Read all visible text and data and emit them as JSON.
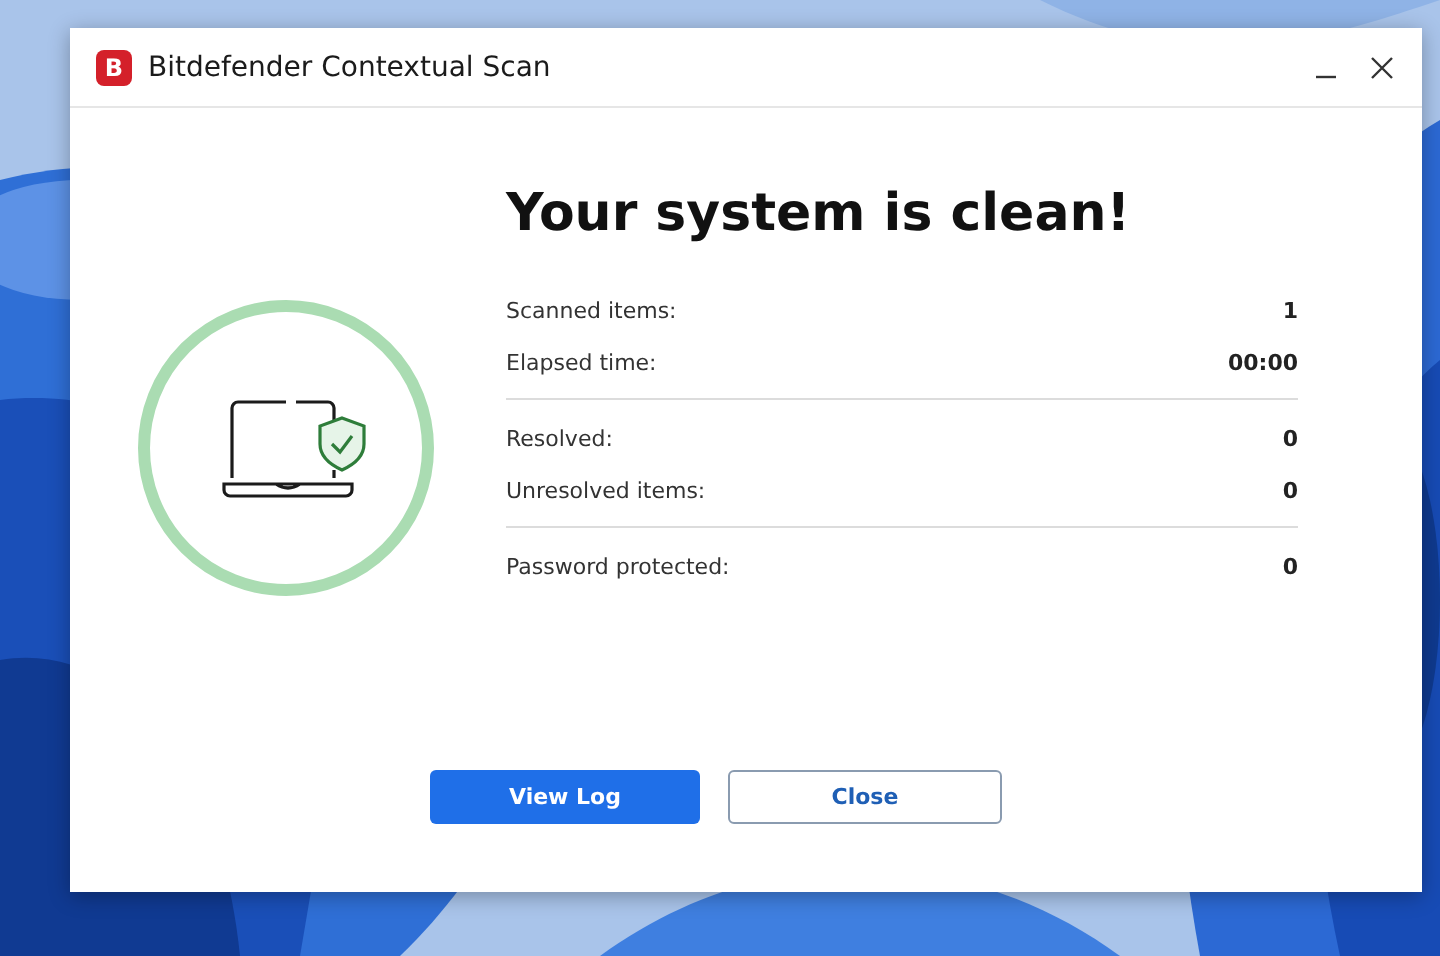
{
  "window": {
    "logo_letter": "B",
    "title": "Bitdefender Contextual Scan"
  },
  "heading": "Your system is clean!",
  "stat_groups": [
    {
      "items": [
        {
          "label": "Scanned items:",
          "value": "1"
        },
        {
          "label": "Elapsed time:",
          "value": "00:00"
        }
      ]
    },
    {
      "items": [
        {
          "label": "Resolved:",
          "value": "0"
        },
        {
          "label": "Unresolved items:",
          "value": "0"
        }
      ]
    },
    {
      "items": [
        {
          "label": "Password protected:",
          "value": "0"
        }
      ]
    }
  ],
  "buttons": [
    {
      "label": "View Log",
      "kind": "primary"
    },
    {
      "label": "Close",
      "kind": "secondary"
    }
  ]
}
